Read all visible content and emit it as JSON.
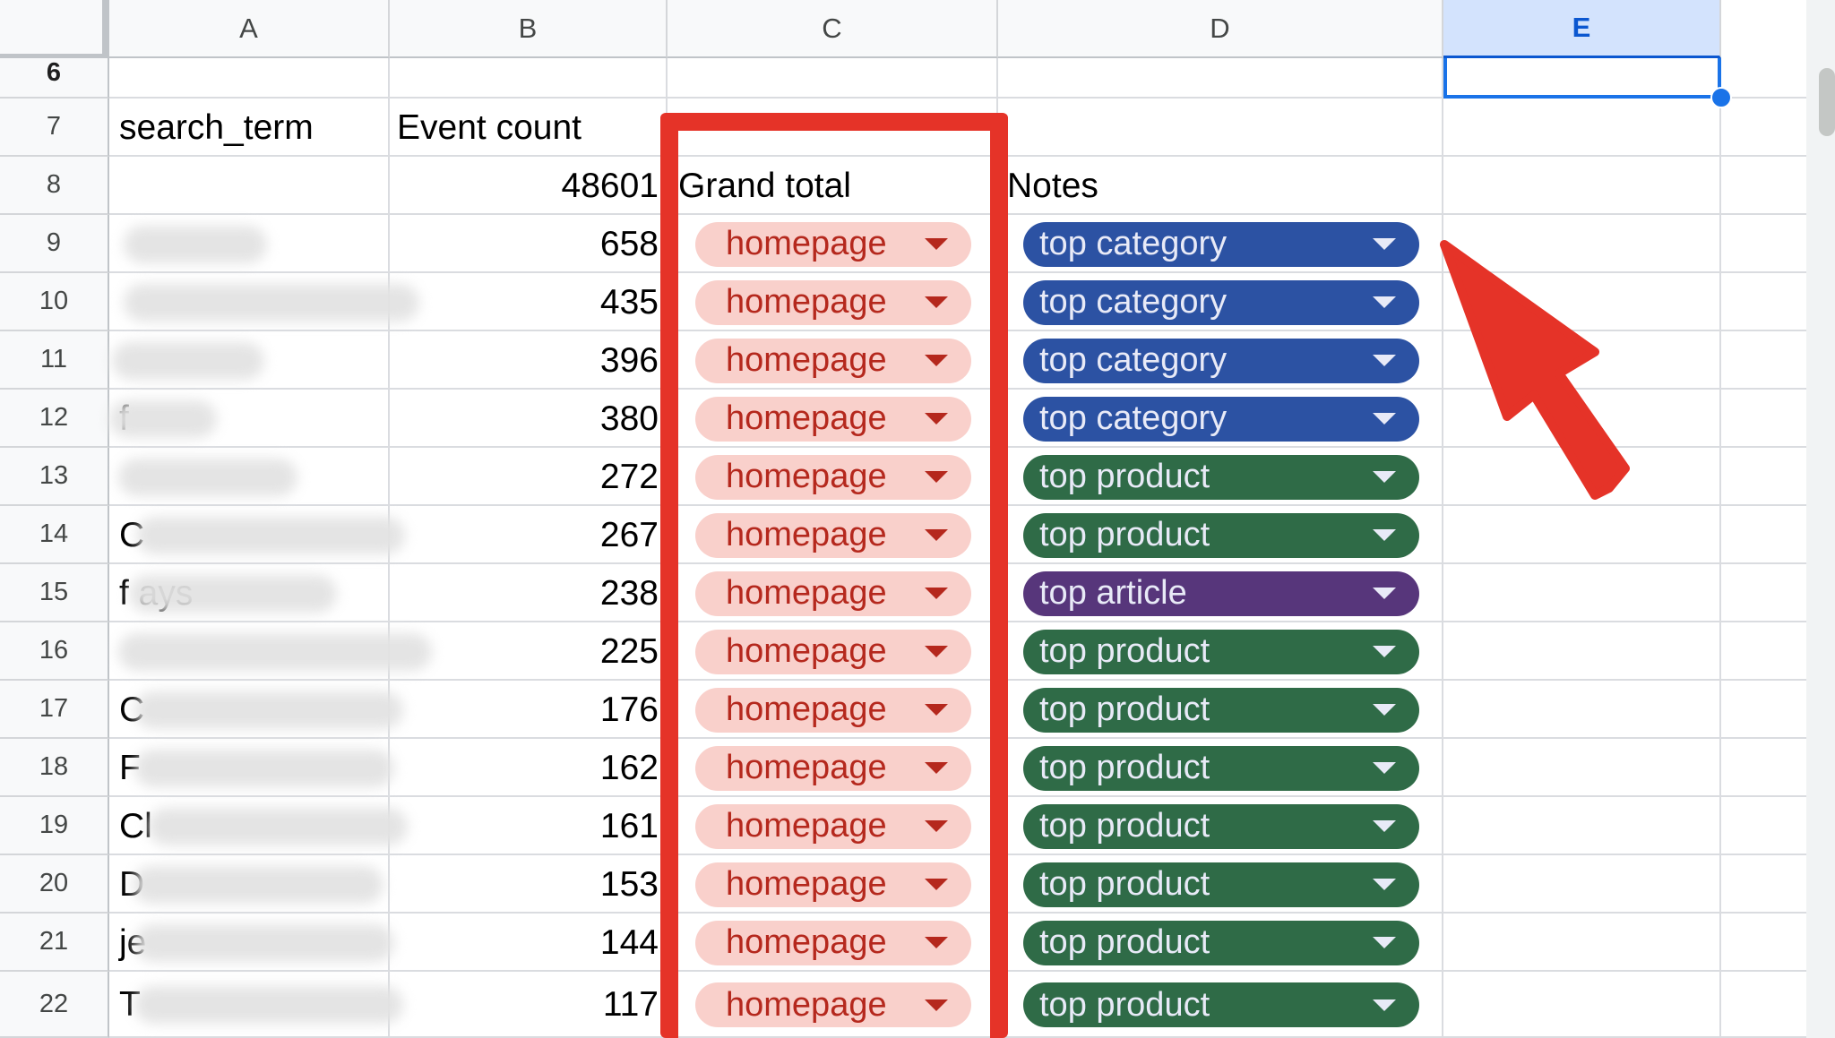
{
  "columns": [
    "A",
    "B",
    "C",
    "D",
    "E"
  ],
  "rows": [
    {
      "row": "6",
      "search_term": "",
      "count": "",
      "grand": "",
      "note": "",
      "note_kind": ""
    },
    {
      "row": "7",
      "search_term": "search_term",
      "count": "Event count",
      "grand": "",
      "note": "",
      "note_kind": ""
    },
    {
      "row": "8",
      "search_term": "",
      "count": "48601",
      "grand": "Grand total",
      "note": "Notes",
      "note_kind": ""
    },
    {
      "row": "9",
      "search_term": "",
      "count": "658",
      "grand": "homepage",
      "note": "top category",
      "note_kind": "category"
    },
    {
      "row": "10",
      "search_term": "",
      "count": "435",
      "grand": "homepage",
      "note": "top category",
      "note_kind": "category"
    },
    {
      "row": "11",
      "search_term": "",
      "count": "396",
      "grand": "homepage",
      "note": "top category",
      "note_kind": "category"
    },
    {
      "row": "12",
      "search_term": "f",
      "count": "380",
      "grand": "homepage",
      "note": "top category",
      "note_kind": "category"
    },
    {
      "row": "13",
      "search_term": "",
      "count": "272",
      "grand": "homepage",
      "note": "top product",
      "note_kind": "product"
    },
    {
      "row": "14",
      "search_term": "C",
      "count": "267",
      "grand": "homepage",
      "note": "top product",
      "note_kind": "product"
    },
    {
      "row": "15",
      "search_term": "f                ays",
      "count": "238",
      "grand": "homepage",
      "note": "top article",
      "note_kind": "article"
    },
    {
      "row": "16",
      "search_term": "",
      "count": "225",
      "grand": "homepage",
      "note": "top product",
      "note_kind": "product"
    },
    {
      "row": "17",
      "search_term": "C",
      "count": "176",
      "grand": "homepage",
      "note": "top product",
      "note_kind": "product"
    },
    {
      "row": "18",
      "search_term": "F",
      "count": "162",
      "grand": "homepage",
      "note": "top product",
      "note_kind": "product"
    },
    {
      "row": "19",
      "search_term": "Cl",
      "count": "161",
      "grand": "homepage",
      "note": "top product",
      "note_kind": "product"
    },
    {
      "row": "20",
      "search_term": "D",
      "count": "153",
      "grand": "homepage",
      "note": "top product",
      "note_kind": "product"
    },
    {
      "row": "21",
      "search_term": "je",
      "count": "144",
      "grand": "homepage",
      "note": "top product",
      "note_kind": "product"
    },
    {
      "row": "22",
      "search_term": "T",
      "count": "117",
      "grand": "homepage",
      "note": "top product",
      "note_kind": "product"
    }
  ],
  "colors": {
    "chip_homepage_bg": "#f9d0cb",
    "chip_homepage_text": "#b5281d",
    "chip_category_bg": "#2c52a3",
    "chip_product_bg": "#2f6b47",
    "chip_article_bg": "#57367b",
    "selection": "#1a73e8",
    "annotation_red": "#e53328"
  },
  "icons": {
    "dropdown": "triangle-down-icon",
    "annotation": "arrow-pointer-icon"
  }
}
